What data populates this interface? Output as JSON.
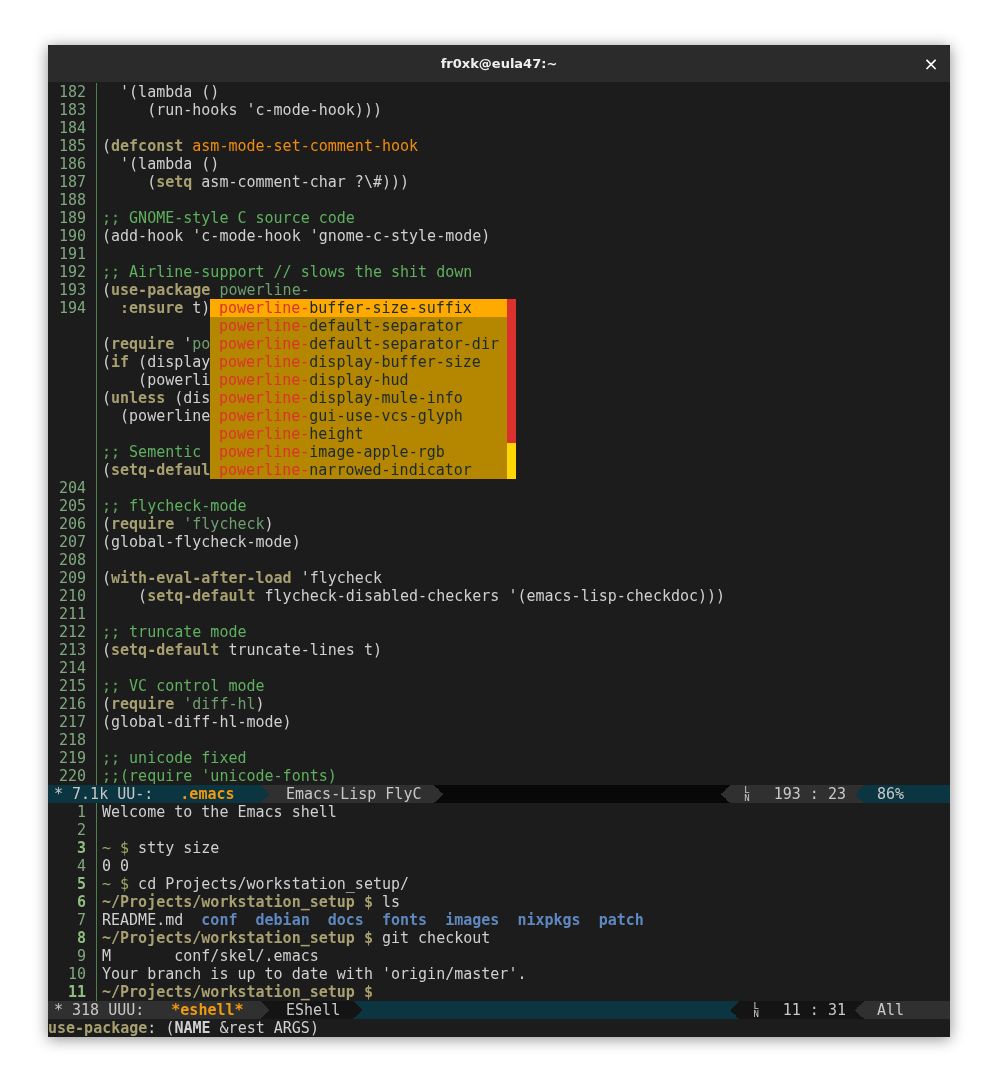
{
  "window": {
    "title": "fr0xk@eula47:~",
    "close": "×"
  },
  "editor": {
    "lines": [
      {
        "kind": "code",
        "num": "182",
        "parts": [
          {
            "text": "  '(lambda ()",
            "kind": "plain"
          }
        ]
      },
      {
        "kind": "code",
        "num": "183",
        "parts": [
          {
            "text": "     (run-hooks 'c-mode-hook)))",
            "kind": "plain"
          }
        ]
      },
      {
        "kind": "blank",
        "num": "184"
      },
      {
        "kind": "code",
        "num": "185",
        "parts": [
          {
            "text": "(",
            "kind": "plain"
          },
          {
            "text": "defconst",
            "kind": "kw"
          },
          {
            "text": " asm-mode-set-comment-hook",
            "kind": "const"
          }
        ]
      },
      {
        "kind": "code",
        "num": "186",
        "parts": [
          {
            "text": "  '(lambda ()",
            "kind": "plain"
          }
        ]
      },
      {
        "kind": "code",
        "num": "187",
        "parts": [
          {
            "text": "     (",
            "kind": "plain"
          },
          {
            "text": "setq",
            "kind": "kw"
          },
          {
            "text": " asm-comment-char ?\\#)))",
            "kind": "plain"
          }
        ]
      },
      {
        "kind": "blank",
        "num": "188"
      },
      {
        "kind": "code",
        "num": "189",
        "parts": [
          {
            "text": ";; GNOME-style C source code",
            "kind": "comment"
          }
        ]
      },
      {
        "kind": "code",
        "num": "190",
        "parts": [
          {
            "text": "(add-hook 'c-mode-hook 'gnome-c-style-mode)",
            "kind": "plain"
          }
        ]
      },
      {
        "kind": "blank",
        "num": "191"
      },
      {
        "kind": "code",
        "num": "192",
        "parts": [
          {
            "text": ";; Airline-support // slows the shit down",
            "kind": "comment"
          }
        ]
      },
      {
        "kind": "code",
        "num": "193",
        "parts": [
          {
            "text": "(",
            "kind": "plain"
          },
          {
            "text": "use-package",
            "kind": "kw"
          },
          {
            "text": " powerline-",
            "kind": "sym"
          }
        ]
      },
      {
        "kind": "code",
        "num": "194",
        "parts": [
          {
            "text": "  :ensure",
            "kind": "kw"
          },
          {
            "text": " t)",
            "kind": "plain"
          }
        ]
      },
      {
        "kind": "blank"
      },
      {
        "kind": "code",
        "parts": [
          {
            "text": "(",
            "kind": "plain"
          },
          {
            "text": "require",
            "kind": "kw"
          },
          {
            "text": " '",
            "kind": "plain"
          },
          {
            "text": "po",
            "kind": "sym"
          }
        ]
      },
      {
        "kind": "code",
        "parts": [
          {
            "text": "(",
            "kind": "plain"
          },
          {
            "text": "if",
            "kind": "kw"
          },
          {
            "text": " (display",
            "kind": "plain"
          }
        ]
      },
      {
        "kind": "code",
        "parts": [
          {
            "text": "    (powerli",
            "kind": "plain"
          }
        ]
      },
      {
        "kind": "code",
        "parts": [
          {
            "text": "(",
            "kind": "plain"
          },
          {
            "text": "unless",
            "kind": "kw"
          },
          {
            "text": " (dis",
            "kind": "plain"
          }
        ]
      },
      {
        "kind": "code",
        "parts": [
          {
            "text": "  (powerline",
            "kind": "plain"
          }
        ]
      },
      {
        "kind": "blank"
      },
      {
        "kind": "code",
        "parts": [
          {
            "text": ";; Sementic",
            "kind": "comment"
          }
        ]
      },
      {
        "kind": "code",
        "parts": [
          {
            "text": "(",
            "kind": "plain"
          },
          {
            "text": "setq-defaul",
            "kind": "kw"
          }
        ]
      },
      {
        "kind": "blank",
        "num": "204"
      },
      {
        "kind": "code",
        "num": "205",
        "parts": [
          {
            "text": ";; flycheck-mode",
            "kind": "comment"
          }
        ]
      },
      {
        "kind": "code",
        "num": "206",
        "parts": [
          {
            "text": "(",
            "kind": "plain"
          },
          {
            "text": "require",
            "kind": "kw"
          },
          {
            "text": " 'flycheck",
            "kind": "sym"
          },
          {
            "text": ")",
            "kind": "plain"
          }
        ]
      },
      {
        "kind": "code",
        "num": "207",
        "parts": [
          {
            "text": "(global-flycheck-mode)",
            "kind": "plain"
          }
        ]
      },
      {
        "kind": "blank",
        "num": "208"
      },
      {
        "kind": "code",
        "num": "209",
        "parts": [
          {
            "text": "(",
            "kind": "plain"
          },
          {
            "text": "with-eval-after-load",
            "kind": "kw"
          },
          {
            "text": " 'flycheck",
            "kind": "plain"
          }
        ]
      },
      {
        "kind": "code",
        "num": "210",
        "parts": [
          {
            "text": "    (",
            "kind": "plain"
          },
          {
            "text": "setq-default",
            "kind": "kw"
          },
          {
            "text": " flycheck-disabled-checkers '(emacs-lisp-checkdoc)))",
            "kind": "plain"
          }
        ]
      },
      {
        "kind": "blank",
        "num": "211"
      },
      {
        "kind": "code",
        "num": "212",
        "parts": [
          {
            "text": ";; truncate mode",
            "kind": "comment"
          }
        ]
      },
      {
        "kind": "code",
        "num": "213",
        "parts": [
          {
            "text": "(",
            "kind": "plain"
          },
          {
            "text": "setq-default",
            "kind": "kw"
          },
          {
            "text": " truncate-lines t)",
            "kind": "plain"
          }
        ]
      },
      {
        "kind": "blank",
        "num": "214"
      },
      {
        "kind": "code",
        "num": "215",
        "parts": [
          {
            "text": ";; VC control mode",
            "kind": "comment"
          }
        ]
      },
      {
        "kind": "code",
        "num": "216",
        "parts": [
          {
            "text": "(",
            "kind": "plain"
          },
          {
            "text": "require",
            "kind": "kw"
          },
          {
            "text": " 'diff-hl",
            "kind": "sym"
          },
          {
            "text": ")",
            "kind": "plain"
          }
        ]
      },
      {
        "kind": "code",
        "num": "217",
        "parts": [
          {
            "text": "(global-diff-hl-mode)",
            "kind": "plain"
          }
        ]
      },
      {
        "kind": "blank",
        "num": "218"
      },
      {
        "kind": "code",
        "num": "219",
        "parts": [
          {
            "text": ";; unicode fixed",
            "kind": "comment"
          }
        ]
      },
      {
        "kind": "code",
        "num": "220",
        "parts": [
          {
            "text": ";;(require 'unicode-fonts)",
            "kind": "comment"
          }
        ]
      }
    ],
    "completions": [
      {
        "prefix": "powerline-",
        "rest": "buffer-size-suffix",
        "selected": true
      },
      {
        "prefix": "powerline-",
        "rest": "default-separator",
        "selected": false
      },
      {
        "prefix": "powerline-",
        "rest": "default-separator-dir",
        "selected": false
      },
      {
        "prefix": "powerline-",
        "rest": "display-buffer-size",
        "selected": false
      },
      {
        "prefix": "powerline-",
        "rest": "display-hud",
        "selected": false
      },
      {
        "prefix": "powerline-",
        "rest": "display-mule-info",
        "selected": false
      },
      {
        "prefix": "powerline-",
        "rest": "gui-use-vcs-glyph",
        "selected": false
      },
      {
        "prefix": "powerline-",
        "rest": "height",
        "selected": false
      },
      {
        "prefix": "powerline-",
        "rest": "image-apple-rgb",
        "selected": false
      },
      {
        "prefix": "powerline-",
        "rest": "narrowed-indicator",
        "selected": false
      }
    ],
    "mode_line": {
      "active": true,
      "status": "* 7.1k UU-:",
      "buffer": ".emacs",
      "mode": "Emacs-Lisp FlyC",
      "ln_glyph": "LN",
      "position": "193 : 23",
      "scroll": "86%"
    }
  },
  "shell": {
    "lines": [
      {
        "kind": "code",
        "num": "1",
        "prompt": false,
        "parts": [
          {
            "text": "Welcome to the Emacs shell",
            "kind": "plain"
          }
        ]
      },
      {
        "kind": "blank",
        "num": "2",
        "prompt": false
      },
      {
        "kind": "code",
        "num": "3",
        "prompt": true,
        "parts": [
          {
            "text": "~ $",
            "kind": "tilde"
          },
          {
            "text": " stty size",
            "kind": "plain"
          }
        ]
      },
      {
        "kind": "code",
        "num": "4",
        "prompt": false,
        "parts": [
          {
            "text": "0 0",
            "kind": "plain"
          }
        ]
      },
      {
        "kind": "code",
        "num": "5",
        "prompt": true,
        "parts": [
          {
            "text": "~ $",
            "kind": "tilde"
          },
          {
            "text": " cd Projects/workstation_setup/",
            "kind": "plain"
          }
        ]
      },
      {
        "kind": "code",
        "num": "6",
        "prompt": true,
        "parts": [
          {
            "text": "~/Projects/workstation_setup $",
            "kind": "path"
          },
          {
            "text": " ls",
            "kind": "plain"
          }
        ]
      },
      {
        "kind": "code",
        "num": "7",
        "prompt": false,
        "parts": [
          {
            "text": "README.md  ",
            "kind": "plain"
          },
          {
            "text": "conf",
            "kind": "dir"
          },
          {
            "text": "  debian",
            "kind": "dir"
          },
          {
            "text": "  docs",
            "kind": "dir"
          },
          {
            "text": "  fonts",
            "kind": "dir"
          },
          {
            "text": "  images",
            "kind": "dir"
          },
          {
            "text": "  nixpkgs",
            "kind": "dir"
          },
          {
            "text": "  patch",
            "kind": "dir"
          }
        ]
      },
      {
        "kind": "code",
        "num": "8",
        "prompt": true,
        "parts": [
          {
            "text": "~/Projects/workstation_setup $",
            "kind": "path"
          },
          {
            "text": " git checkout",
            "kind": "plain"
          }
        ]
      },
      {
        "kind": "code",
        "num": "9",
        "prompt": false,
        "parts": [
          {
            "text": "M       conf/skel/.emacs",
            "kind": "plain"
          }
        ]
      },
      {
        "kind": "code",
        "num": "10",
        "prompt": false,
        "parts": [
          {
            "text": "Your branch is up to date with 'origin/master'.",
            "kind": "plain"
          }
        ]
      },
      {
        "kind": "code",
        "num": "11",
        "prompt": true,
        "parts": [
          {
            "text": "~/Projects/workstation_setup $",
            "kind": "path"
          }
        ]
      }
    ],
    "mode_line": {
      "active": false,
      "status": "* 318 UUU:",
      "buffer": "*eshell*",
      "mode": "EShell",
      "ln_glyph": "LN",
      "position": "11 : 31",
      "scroll": "All"
    }
  },
  "minibuffer": {
    "parts": [
      {
        "text": "use-package",
        "kind": "kw"
      },
      {
        "text": ": (",
        "kind": "plain"
      },
      {
        "text": "NAME",
        "kind": "bold"
      },
      {
        "text": " &rest ARGS)",
        "kind": "plain"
      }
    ]
  }
}
